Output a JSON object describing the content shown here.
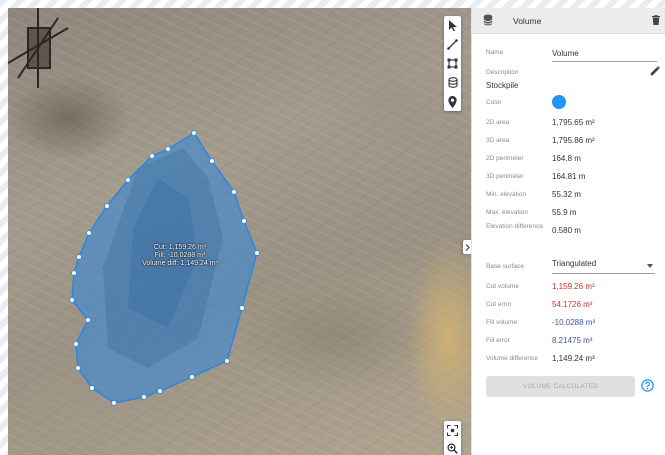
{
  "map": {
    "polygon_label": [
      "Cut: 1,159.26 m³",
      "Fill: -10.0288 m³",
      "Volume diff: 1,149.24 m³"
    ]
  },
  "toolbar": {
    "tools": [
      "select-pointer-icon",
      "measure-line-icon",
      "measure-area-icon",
      "measure-volume-icon",
      "location-pin-icon"
    ],
    "zoom_tools": [
      "zoom-fit-icon",
      "zoom-search-icon"
    ]
  },
  "panel": {
    "header_title": "Volume",
    "name_label": "Name",
    "name_value": "Volume",
    "description_label": "Description",
    "description_value": "Stockpile",
    "color_label": "Color",
    "color_value": "#2196f3",
    "rows": [
      {
        "label": "2D area",
        "value": "1,795.65 m²"
      },
      {
        "label": "3D area",
        "value": "1,795.86 m²"
      },
      {
        "label": "2D perimeter",
        "value": "164.8 m"
      },
      {
        "label": "3D perimeter",
        "value": "164.81 m"
      },
      {
        "label": "Min. elevation",
        "value": "55.32 m"
      },
      {
        "label": "Max. elevation",
        "value": "55.9 m"
      },
      {
        "label": "Elevation difference",
        "value": "0.580 m"
      }
    ],
    "base_surface_label": "Base surface",
    "base_surface_value": "Triangulated",
    "results": [
      {
        "label": "Cut volume",
        "value": "1,159.26 m³",
        "color": "#d32f2f"
      },
      {
        "label": "Cut error",
        "value": "54.1726 m³",
        "color": "#d32f2f"
      },
      {
        "label": "Fill volume",
        "value": "-10.0288 m³",
        "color": "#3f51b5"
      },
      {
        "label": "Fill error",
        "value": "8.21475 m³",
        "color": "#3f51b5"
      },
      {
        "label": "Volume difference",
        "value": "1,149.24 m³",
        "color": "#333333"
      }
    ],
    "calc_button_label": "VOLUME CALCULATED"
  }
}
